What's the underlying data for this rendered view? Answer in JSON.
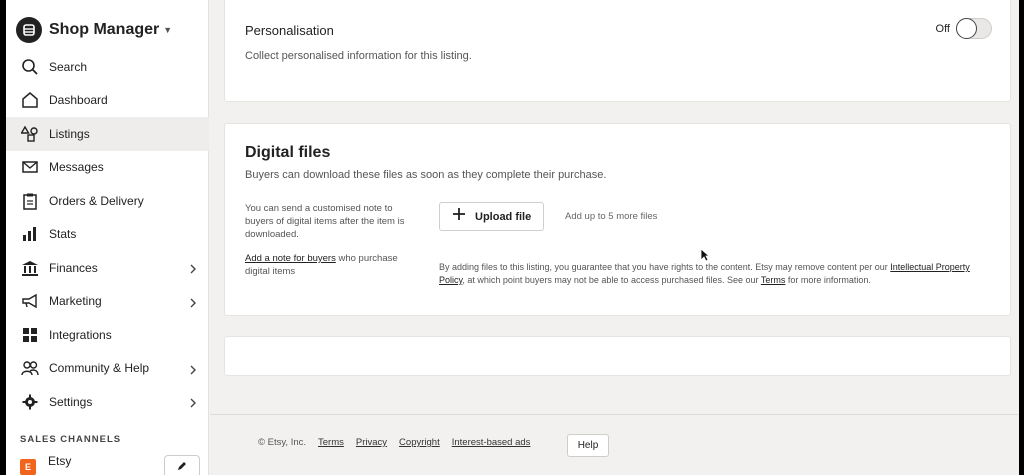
{
  "brand": {
    "title": "Shop Manager"
  },
  "sidebar": {
    "items": [
      {
        "label": "Search",
        "icon": "search-icon"
      },
      {
        "label": "Dashboard",
        "icon": "home-icon"
      },
      {
        "label": "Listings",
        "icon": "shapes-icon",
        "active": true
      },
      {
        "label": "Messages",
        "icon": "mail-icon"
      },
      {
        "label": "Orders & Delivery",
        "icon": "clipboard-icon"
      },
      {
        "label": "Stats",
        "icon": "bar-chart-icon"
      },
      {
        "label": "Finances",
        "icon": "bank-icon",
        "chevron": true
      },
      {
        "label": "Marketing",
        "icon": "megaphone-icon",
        "chevron": true
      },
      {
        "label": "Integrations",
        "icon": "grid-icon"
      },
      {
        "label": "Community & Help",
        "icon": "people-icon",
        "chevron": true
      },
      {
        "label": "Settings",
        "icon": "gear-icon",
        "chevron": true
      }
    ],
    "section_title": "SALES CHANNELS",
    "channel": {
      "badge": "E",
      "label": "Etsy"
    }
  },
  "personalisation": {
    "title": "Personalisation",
    "description": "Collect personalised information for this listing.",
    "toggle_label": "Off"
  },
  "digital_files": {
    "title": "Digital files",
    "description": "Buyers can download these files as soon as they complete their purchase.",
    "note": "You can send a customised note to buyers of digital items after the item is downloaded.",
    "add_note_link": "Add a note for buyers",
    "add_note_rest": " who purchase digital items",
    "upload_label": "Upload file",
    "add_more": "Add up to 5 more files",
    "legal_part1": "By adding files to this listing, you guarantee that you have rights to the content. Etsy may remove content per our ",
    "legal_link1": "Intellectual Property Policy",
    "legal_part2": ", at which point buyers may not be able to access purchased files. See our ",
    "legal_link2": "Terms",
    "legal_part3": " for more information."
  },
  "footer": {
    "copyright": "© Etsy, Inc.",
    "links": [
      "Terms",
      "Privacy",
      "Copyright",
      "Interest-based ads"
    ],
    "help_label": "Help"
  },
  "colors": {
    "accent": "#f1641e",
    "background": "#f2f1ef"
  }
}
